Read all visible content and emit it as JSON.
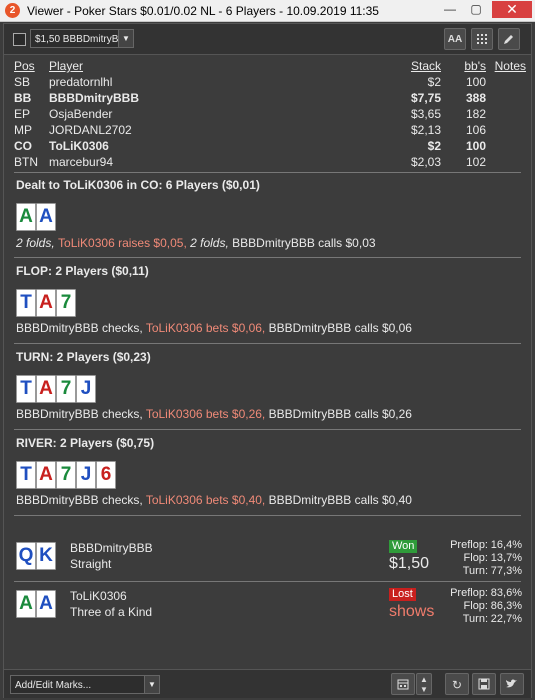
{
  "window": {
    "app_icon": "2",
    "title": "Viewer - Poker Stars $0.01/0.02 NL - 6 Players - 10.09.2019 11:35",
    "minimize": "—",
    "maximize": "▢",
    "close": "✕"
  },
  "toolbar": {
    "hand_selector": "$1,50 BBBDmitryBBB",
    "font_button": "AA",
    "grid_icon": "grid-icon",
    "edit_icon": "pencil-icon"
  },
  "players": {
    "headers": {
      "pos": "Pos",
      "player": "Player",
      "stack": "Stack",
      "bb": "bb's",
      "notes": "Notes"
    },
    "rows": [
      {
        "pos": "SB",
        "player": "predatornlhl",
        "stack": "$2",
        "bb": "100",
        "bold": false
      },
      {
        "pos": "BB",
        "player": "BBBDmitryBBB",
        "stack": "$7,75",
        "bb": "388",
        "bold": true
      },
      {
        "pos": "EP",
        "player": "OsjaBender",
        "stack": "$3,65",
        "bb": "182",
        "bold": false
      },
      {
        "pos": "MP",
        "player": "JORDANL2702",
        "stack": "$2,13",
        "bb": "106",
        "bold": false
      },
      {
        "pos": "CO",
        "player": "ToLiK0306",
        "stack": "$2",
        "bb": "100",
        "bold": true
      },
      {
        "pos": "BTN",
        "player": "marcebur94",
        "stack": "$2,03",
        "bb": "102",
        "bold": false
      }
    ]
  },
  "streets": {
    "preflop": {
      "title": "Dealt to ToLiK0306 in CO: 6 Players ($0,01)",
      "cards": [
        {
          "rank": "A",
          "suit": "c"
        },
        {
          "rank": "A",
          "suit": "s"
        }
      ],
      "actions": [
        {
          "text": "2 folds, ",
          "style": "it"
        },
        {
          "text": "ToLiK0306 raises $0,05, ",
          "style": "hero"
        },
        {
          "text": "2 folds, ",
          "style": "it"
        },
        {
          "text": "BBBDmitryBBB calls $0,03",
          "style": ""
        }
      ]
    },
    "flop": {
      "title": "FLOP: 2 Players ($0,11)",
      "cards": [
        {
          "rank": "T",
          "suit": "s"
        },
        {
          "rank": "A",
          "suit": "h"
        },
        {
          "rank": "7",
          "suit": "c"
        }
      ],
      "actions": [
        {
          "text": "BBBDmitryBBB checks, ",
          "style": ""
        },
        {
          "text": "ToLiK0306 bets $0,06, ",
          "style": "hero"
        },
        {
          "text": "BBBDmitryBBB calls $0,06",
          "style": ""
        }
      ]
    },
    "turn": {
      "title": "TURN: 2 Players ($0,23)",
      "cards": [
        {
          "rank": "T",
          "suit": "s"
        },
        {
          "rank": "A",
          "suit": "h"
        },
        {
          "rank": "7",
          "suit": "c"
        },
        {
          "rank": "J",
          "suit": "d"
        }
      ],
      "actions": [
        {
          "text": "BBBDmitryBBB checks, ",
          "style": ""
        },
        {
          "text": "ToLiK0306 bets $0,26, ",
          "style": "hero"
        },
        {
          "text": "BBBDmitryBBB calls $0,26",
          "style": ""
        }
      ]
    },
    "river": {
      "title": "RIVER: 2 Players ($0,75)",
      "cards": [
        {
          "rank": "T",
          "suit": "s"
        },
        {
          "rank": "A",
          "suit": "h"
        },
        {
          "rank": "7",
          "suit": "c"
        },
        {
          "rank": "J",
          "suit": "d"
        },
        {
          "rank": "6",
          "suit": "h"
        }
      ],
      "actions": [
        {
          "text": "BBBDmitryBBB checks, ",
          "style": ""
        },
        {
          "text": "ToLiK0306 bets $0,40, ",
          "style": "hero"
        },
        {
          "text": "BBBDmitryBBB calls $0,40",
          "style": ""
        }
      ]
    }
  },
  "summary": [
    {
      "cards": [
        {
          "rank": "Q",
          "suit": "s"
        },
        {
          "rank": "K",
          "suit": "s"
        }
      ],
      "name": "BBBDmitryBBB",
      "hand": "Straight",
      "result": "Won",
      "result_type": "won",
      "amount": "$1,50",
      "stats": [
        {
          "label": "Preflop:",
          "value": "16,4%"
        },
        {
          "label": "Flop:",
          "value": "13,7%"
        },
        {
          "label": "Turn:",
          "value": "77,3%"
        }
      ]
    },
    {
      "cards": [
        {
          "rank": "A",
          "suit": "c"
        },
        {
          "rank": "A",
          "suit": "s"
        }
      ],
      "name": "ToLiK0306",
      "hand": "Three of a Kind",
      "result": "Lost",
      "result_type": "lost",
      "amount": "shows",
      "stats": [
        {
          "label": "Preflop:",
          "value": "83,6%"
        },
        {
          "label": "Flop:",
          "value": "86,3%"
        },
        {
          "label": "Turn:",
          "value": "22,7%"
        }
      ]
    }
  ],
  "bottom": {
    "marks_placeholder": "Add/Edit Marks...",
    "calendar_icon": "calendar-icon",
    "spinner_icon": "spinner-icon",
    "replay_icon": "replay-icon",
    "save_icon": "save-icon",
    "twitter_icon": "twitter-icon"
  },
  "colors": {
    "background": "#3c3c3c",
    "hero_action": "#f08a78",
    "won_badge": "#2f9b3a",
    "lost_badge": "#c8201e",
    "spade": "#1f4fc0",
    "heart": "#c8201e",
    "club": "#1a8a3c",
    "diamond": "#1f4fc0"
  }
}
